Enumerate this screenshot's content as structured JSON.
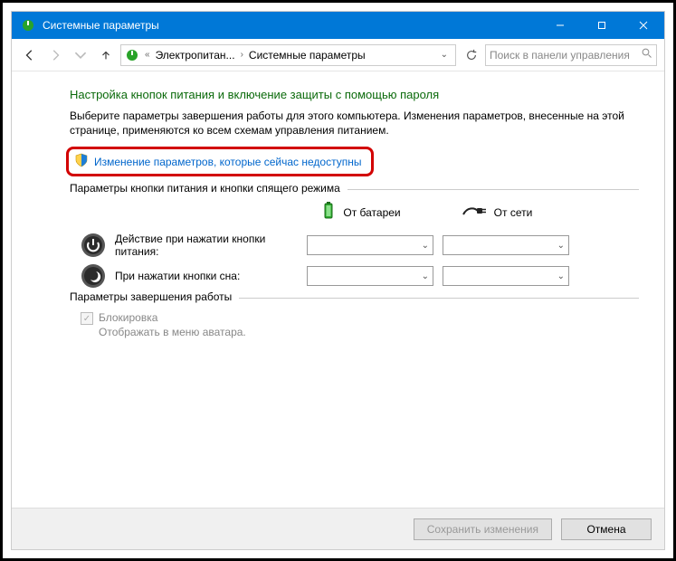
{
  "window": {
    "title": "Системные параметры"
  },
  "breadcrumb": {
    "prefix": "«",
    "items": [
      "Электропитан...",
      "Системные параметры"
    ]
  },
  "search": {
    "placeholder": "Поиск в панели управления"
  },
  "main": {
    "heading": "Настройка кнопок питания и включение защиты с помощью пароля",
    "description": "Выберите параметры завершения работы для этого компьютера. Изменения параметров, внесенные на этой странице, применяются ко всем схемам управления питанием.",
    "change_link": "Изменение параметров, которые сейчас недоступны"
  },
  "group1": {
    "legend": "Параметры кнопки питания и кнопки спящего режима",
    "col_battery": "От батареи",
    "col_ac": "От сети",
    "rows": [
      {
        "label": "Действие при нажатии кнопки питания:"
      },
      {
        "label": "При нажатии кнопки сна:"
      }
    ]
  },
  "group2": {
    "legend": "Параметры завершения работы",
    "lock_label": "Блокировка",
    "lock_sub": "Отображать в меню аватара."
  },
  "footer": {
    "save": "Сохранить изменения",
    "cancel": "Отмена"
  }
}
